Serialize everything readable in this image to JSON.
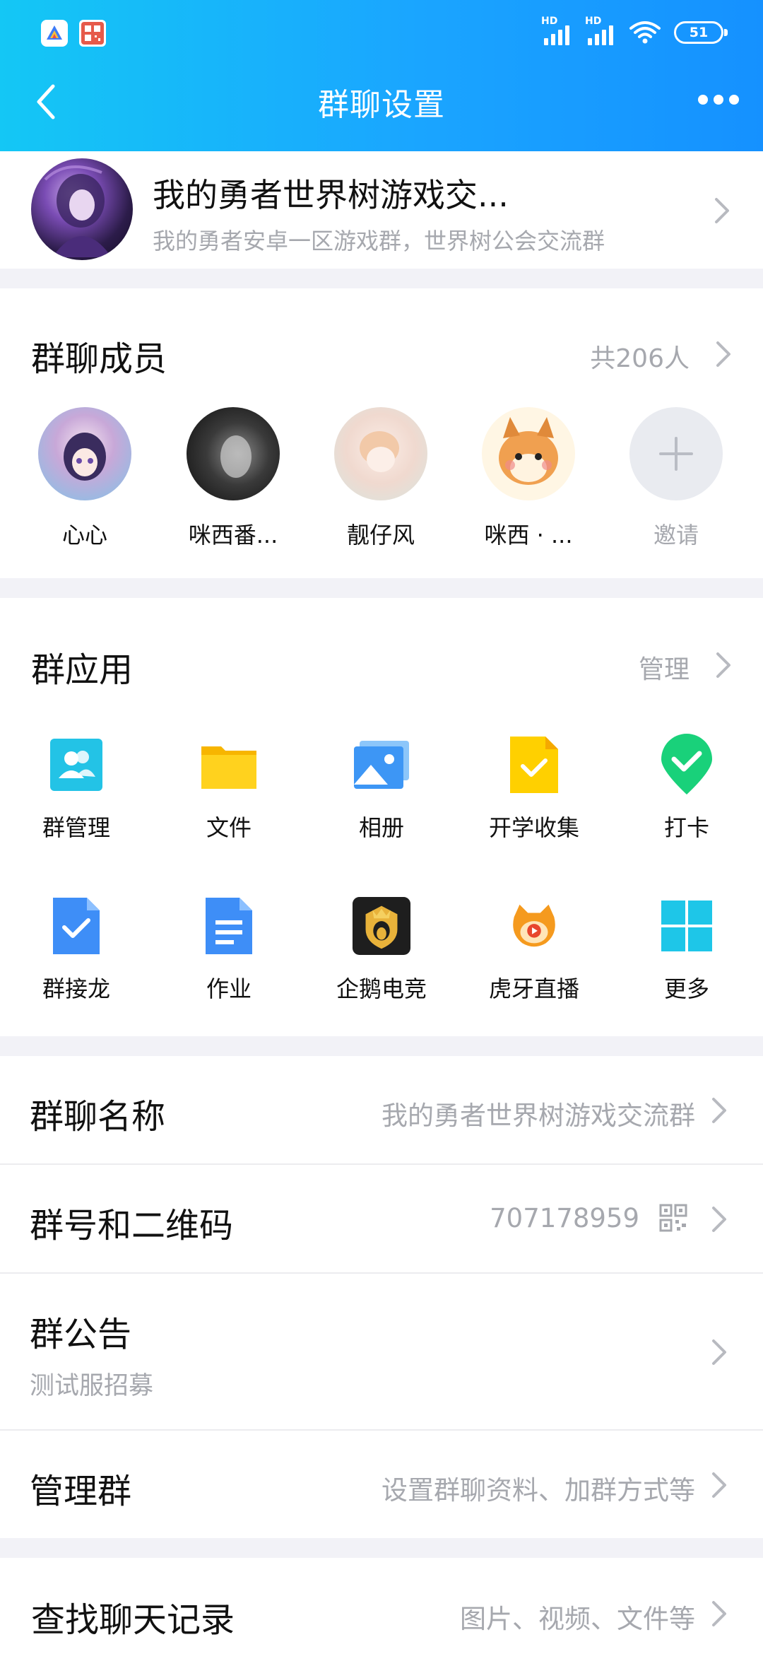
{
  "status_bar": {
    "battery_level": "51",
    "signal1_label": "HD",
    "signal2_label": "HD"
  },
  "header": {
    "title": "群聊设置"
  },
  "group": {
    "name": "我的勇者世界树游戏交...",
    "description": "我的勇者安卓一区游戏群，世界树公会交流群"
  },
  "members_section": {
    "title": "群聊成员",
    "count": "共206人",
    "members": [
      {
        "name": "心心"
      },
      {
        "name": "咪西番..."
      },
      {
        "name": "靓仔风"
      },
      {
        "name": "咪西 · ..."
      }
    ],
    "invite_label": "邀请"
  },
  "apps_section": {
    "title": "群应用",
    "manage_label": "管理",
    "apps": [
      {
        "label": "群管理",
        "icon": "group-manage-icon"
      },
      {
        "label": "文件",
        "icon": "folder-icon"
      },
      {
        "label": "相册",
        "icon": "album-icon"
      },
      {
        "label": "开学收集",
        "icon": "collect-icon"
      },
      {
        "label": "打卡",
        "icon": "checkin-icon"
      },
      {
        "label": "群接龙",
        "icon": "relay-icon"
      },
      {
        "label": "作业",
        "icon": "homework-icon"
      },
      {
        "label": "企鹅电竞",
        "icon": "penguin-esports-icon"
      },
      {
        "label": "虎牙直播",
        "icon": "huya-live-icon"
      },
      {
        "label": "更多",
        "icon": "more-apps-icon"
      }
    ]
  },
  "settings": {
    "group_name_label": "群聊名称",
    "group_name_value": "我的勇者世界树游戏交流群",
    "group_id_label": "群号和二维码",
    "group_id_value": "707178959",
    "announcement_label": "群公告",
    "announcement_value": "测试服招募",
    "manage_label": "管理群",
    "manage_value": "设置群聊资料、加群方式等",
    "search_label": "查找聊天记录",
    "search_value": "图片、视频、文件等"
  },
  "colors": {
    "header_gradient_start": "#14C7F5",
    "header_gradient_end": "#1591FF",
    "muted_text": "#A6A8AE",
    "page_background": "#F2F2F7"
  }
}
